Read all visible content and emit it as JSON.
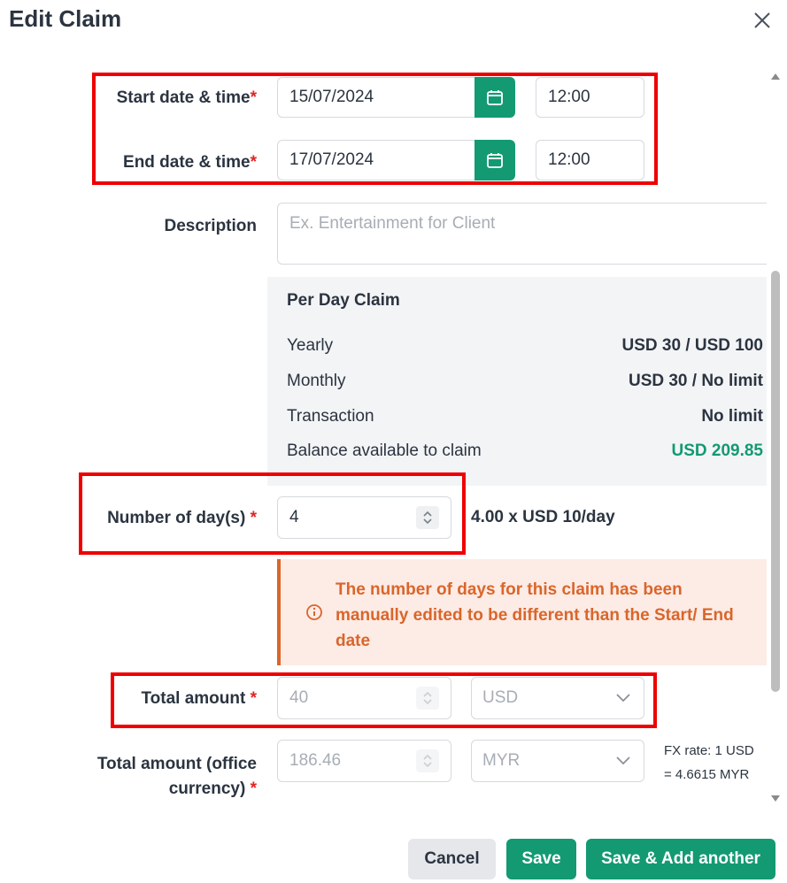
{
  "dialog": {
    "title": "Edit Claim"
  },
  "form": {
    "start": {
      "label": "Start date & time",
      "date": "15/07/2024",
      "time": "12:00"
    },
    "end": {
      "label": "End date & time",
      "date": "17/07/2024",
      "time": "12:00"
    },
    "description": {
      "label": "Description",
      "placeholder": "Ex. Entertainment for Client"
    },
    "per_day": {
      "title": "Per Day Claim",
      "rows": [
        {
          "key": "Yearly",
          "value": "USD 30 / USD 100"
        },
        {
          "key": "Monthly",
          "value": "USD 30 / No limit"
        },
        {
          "key": "Transaction",
          "value": "No limit"
        },
        {
          "key": "Balance available to claim",
          "value": "USD 209.85"
        }
      ]
    },
    "days": {
      "label": "Number of day(s)",
      "value": "4",
      "calc": "4.00 x USD 10/day"
    },
    "warning": "The number of days for this claim has been manually edited to be different than the Start/ End date",
    "total": {
      "label": "Total amount",
      "value": "40",
      "currency": "USD"
    },
    "total_office": {
      "label_line1": "Total amount (office",
      "label_line2": "currency)",
      "value": "186.46",
      "currency": "MYR",
      "fx_line1": "FX rate: 1 USD",
      "fx_line2": "= 4.6615 MYR"
    },
    "required_mark": "*"
  },
  "footer": {
    "cancel": "Cancel",
    "save": "Save",
    "save_add": "Save & Add another"
  },
  "colors": {
    "accent": "#139a72",
    "warning": "#d9662b",
    "required": "#e02424",
    "highlight": "#ee0000"
  },
  "icons": [
    "close-icon",
    "calendar-icon",
    "stepper-icon",
    "info-icon",
    "chevron-down-icon"
  ]
}
